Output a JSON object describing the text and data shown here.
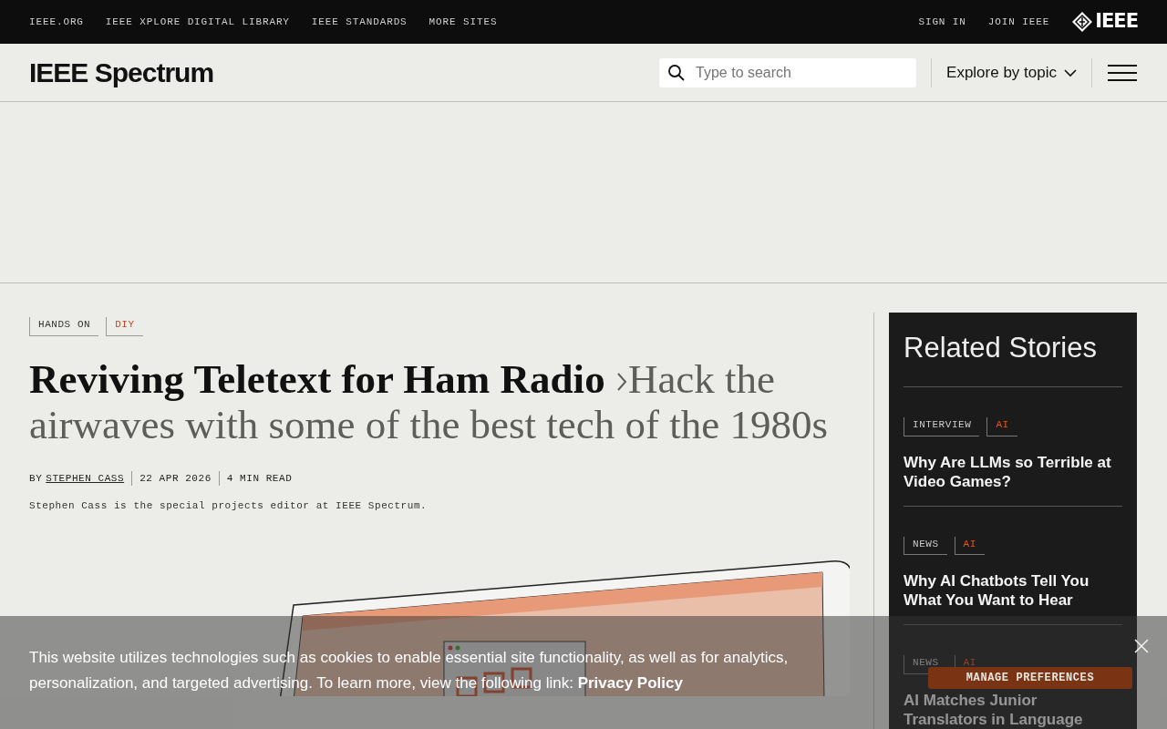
{
  "top_bar": {
    "links": [
      "IEEE.ORG",
      "IEEE XPLORE DIGITAL LIBRARY",
      "IEEE STANDARDS",
      "MORE SITES"
    ],
    "account_links": [
      "SIGN IN",
      "JOIN IEEE"
    ],
    "logo": "IEEE"
  },
  "header": {
    "logo": "IEEE Spectrum",
    "search": {
      "placeholder": "Type to search"
    },
    "explore": "Explore by topic"
  },
  "article": {
    "tags": [
      {
        "label": "HANDS ON",
        "kind": "section"
      },
      {
        "label": "DIY",
        "kind": "topic"
      }
    ],
    "title": "Reviving Teletext for Ham Radio",
    "subtitle": "Hack the airwaves with some of the best tech of the 1980s",
    "byline": {
      "by": "BY",
      "author": "STEPHEN CASS",
      "date": "22 APR 2026",
      "read_time": "4 MIN READ"
    },
    "author_bio": "Stephen Cass is the special projects editor at IEEE Spectrum."
  },
  "related": {
    "title": "Related Stories",
    "stories": [
      {
        "tags": [
          {
            "label": "INTERVIEW",
            "kind": "section"
          },
          {
            "label": "AI",
            "kind": "topic"
          }
        ],
        "title": "Why Are LLMs so Terrible at Video Games?"
      },
      {
        "tags": [
          {
            "label": "NEWS",
            "kind": "section"
          },
          {
            "label": "AI",
            "kind": "topic"
          }
        ],
        "title": "Why AI Chatbots Tell You What You Want to Hear"
      },
      {
        "tags": [
          {
            "label": "NEWS",
            "kind": "section"
          },
          {
            "label": "AI",
            "kind": "topic"
          }
        ],
        "title": "AI Matches Junior Translators in Language"
      }
    ]
  },
  "cookie_banner": {
    "text": "This website utilizes technologies such as cookies to enable essential site functionality, as well as for analytics, personalization, and targeted advertising. To learn more, view the following link:",
    "link": "Privacy Policy",
    "button": "MANAGE PREFERENCES"
  }
}
